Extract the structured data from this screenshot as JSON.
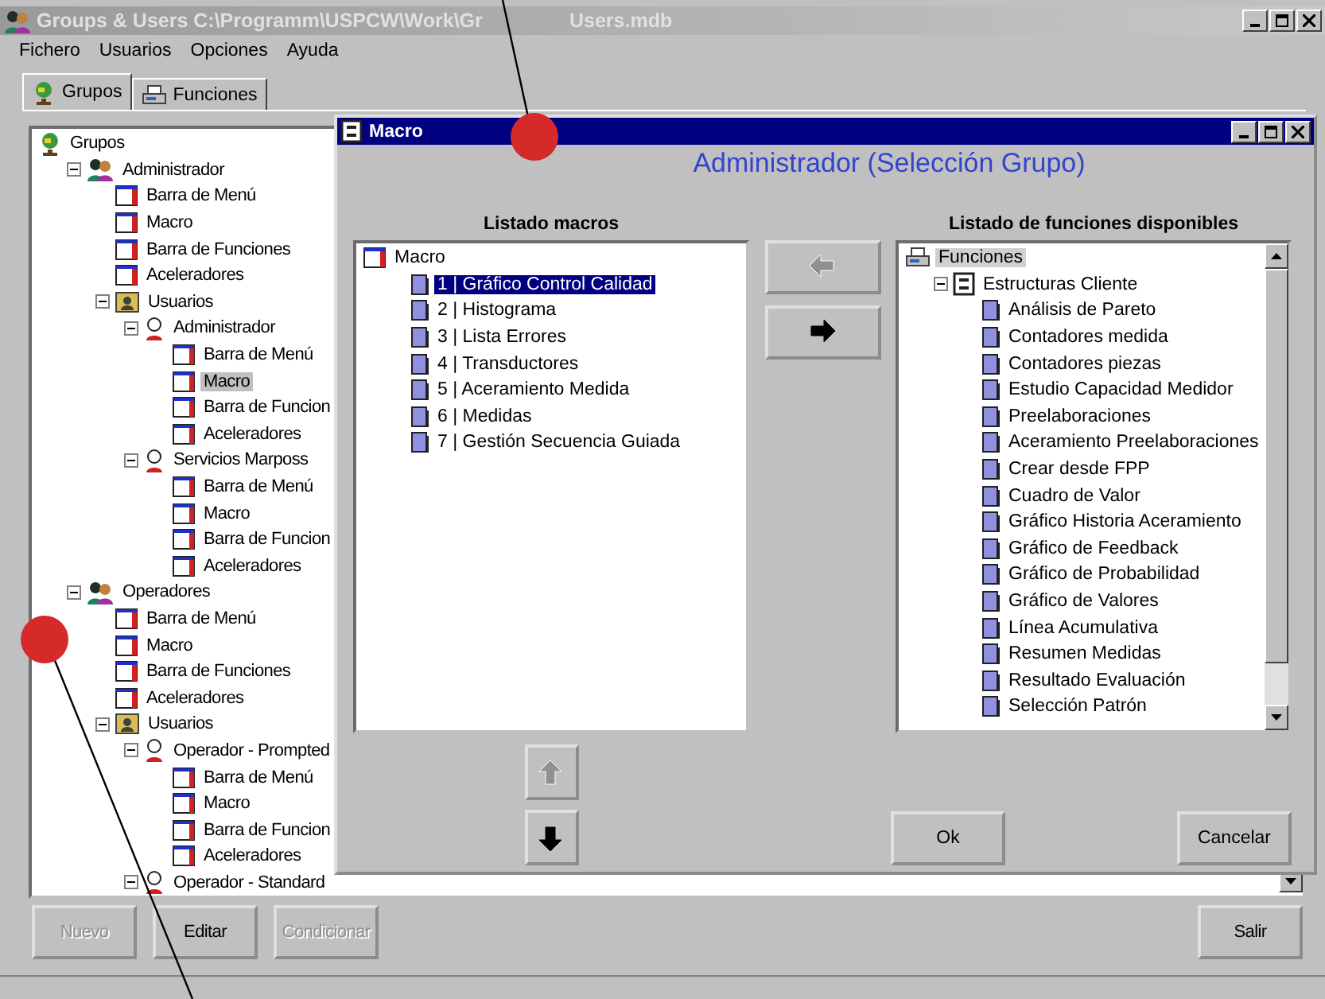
{
  "window": {
    "title_left": "Groups & Users C:\\Programm\\USPCW\\Work\\Gr",
    "title_right": "Users.mdb"
  },
  "menu": [
    "Fichero",
    "Usuarios",
    "Opciones",
    "Ayuda"
  ],
  "tabs": [
    {
      "kind": "groups",
      "label": "Grupos",
      "selected": true
    },
    {
      "kind": "functions",
      "label": "Funciones",
      "selected": false
    }
  ],
  "tree": [
    {
      "kind": "root",
      "label": "Grupos",
      "selected": false,
      "children": [
        {
          "kind": "group",
          "label": "Administrador",
          "expanded": true,
          "selected": false,
          "children": [
            {
              "kind": "leaf",
              "label": "Barra de Menú",
              "selected": false
            },
            {
              "kind": "leaf",
              "label": "Macro",
              "selected": false
            },
            {
              "kind": "leaf",
              "label": "Barra de Funciones",
              "selected": false
            },
            {
              "kind": "leaf",
              "label": "Aceleradores",
              "selected": false
            },
            {
              "kind": "folder",
              "label": "Usuarios",
              "expanded": true,
              "selected": false,
              "children": [
                {
                  "kind": "user",
                  "label": "Administrador",
                  "expanded": true,
                  "selected": false,
                  "children": [
                    {
                      "kind": "leaf",
                      "label": "Barra de Menú",
                      "selected": false
                    },
                    {
                      "kind": "leaf",
                      "label": "Macro",
                      "selected": true
                    },
                    {
                      "kind": "leaf",
                      "label": "Barra de Funcion",
                      "selected": false
                    },
                    {
                      "kind": "leaf",
                      "label": "Aceleradores",
                      "selected": false
                    }
                  ]
                },
                {
                  "kind": "user",
                  "label": "Servicios Marposs",
                  "expanded": true,
                  "selected": false,
                  "children": [
                    {
                      "kind": "leaf",
                      "label": "Barra de Menú",
                      "selected": false
                    },
                    {
                      "kind": "leaf",
                      "label": "Macro",
                      "selected": false
                    },
                    {
                      "kind": "leaf",
                      "label": "Barra de Funcion",
                      "selected": false
                    },
                    {
                      "kind": "leaf",
                      "label": "Aceleradores",
                      "selected": false
                    }
                  ]
                }
              ]
            }
          ]
        },
        {
          "kind": "group",
          "label": "Operadores",
          "expanded": true,
          "selected": false,
          "children": [
            {
              "kind": "leaf",
              "label": "Barra de Menú",
              "selected": false
            },
            {
              "kind": "leaf",
              "label": "Macro",
              "selected": false
            },
            {
              "kind": "leaf",
              "label": "Barra de Funciones",
              "selected": false
            },
            {
              "kind": "leaf",
              "label": "Aceleradores",
              "selected": false
            },
            {
              "kind": "folder",
              "label": "Usuarios",
              "expanded": true,
              "selected": false,
              "children": [
                {
                  "kind": "user",
                  "label": "Operador - Prompted",
                  "expanded": true,
                  "selected": false,
                  "children": [
                    {
                      "kind": "leaf",
                      "label": "Barra de Menú",
                      "selected": false
                    },
                    {
                      "kind": "leaf",
                      "label": "Macro",
                      "selected": false
                    },
                    {
                      "kind": "leaf",
                      "label": "Barra de Funcion",
                      "selected": false
                    },
                    {
                      "kind": "leaf",
                      "label": "Aceleradores",
                      "selected": false
                    }
                  ]
                },
                {
                  "kind": "user",
                  "label": "Operador - Standard",
                  "expanded": true,
                  "selected": false
                }
              ]
            }
          ]
        }
      ]
    }
  ],
  "buttons": [
    {
      "label": "Nuevo",
      "disabled": true
    },
    {
      "label": "Editar",
      "disabled": false
    },
    {
      "label": "Condicionar",
      "disabled": true
    }
  ],
  "exit_button": {
    "label": "Salir",
    "disabled": false
  },
  "dialog": {
    "title": "Macro",
    "heading": "Administrador (Selección Grupo)",
    "macros_label": "Listado macros",
    "macros": [
      {
        "kind": "leaf",
        "label": "Macro",
        "selected": false,
        "children": [
          {
            "kind": "page",
            "label": "1 | Gráfico Control Calidad",
            "selected": true
          },
          {
            "kind": "page",
            "label": "2 | Histograma",
            "selected": false
          },
          {
            "kind": "page",
            "label": "3 | Lista Errores",
            "selected": false
          },
          {
            "kind": "page",
            "label": "4 | Transductores",
            "selected": false
          },
          {
            "kind": "page",
            "label": "5 | Aceramiento Medida",
            "selected": false
          },
          {
            "kind": "page",
            "label": "6 | Medidas",
            "selected": false
          },
          {
            "kind": "page",
            "label": "7 | Gestión Secuencia Guiada",
            "selected": false
          }
        ]
      }
    ],
    "transfer_buttons": [
      {
        "kind": "left",
        "disabled": true
      },
      {
        "kind": "right",
        "disabled": false
      }
    ],
    "functions_label": "Listado de funciones disponibles",
    "functions": [
      {
        "kind": "printer",
        "label": "Funciones",
        "selected": true,
        "children": [
          {
            "kind": "cabinet",
            "label": "Estructuras Cliente",
            "expanded": true,
            "selected": false,
            "children": [
              {
                "kind": "page",
                "label": "Análisis de Pareto",
                "selected": false
              },
              {
                "kind": "page",
                "label": "Contadores medida",
                "selected": false
              },
              {
                "kind": "page",
                "label": "Contadores piezas",
                "selected": false
              },
              {
                "kind": "page",
                "label": "Estudio Capacidad Medidor",
                "selected": false
              },
              {
                "kind": "page",
                "label": "Preelaboraciones",
                "selected": false
              },
              {
                "kind": "page",
                "label": "Aceramiento Preelaboraciones",
                "selected": false
              },
              {
                "kind": "page",
                "label": "Crear desde FPP",
                "selected": false
              },
              {
                "kind": "page",
                "label": "Cuadro de Valor",
                "selected": false
              },
              {
                "kind": "page",
                "label": "Gráfico Historia Aceramiento",
                "selected": false
              },
              {
                "kind": "page",
                "label": "Gráfico de Feedback",
                "selected": false
              },
              {
                "kind": "page",
                "label": "Gráfico de Probabilidad",
                "selected": false
              },
              {
                "kind": "page",
                "label": "Gráfico de Valores",
                "selected": false
              },
              {
                "kind": "page",
                "label": "Línea Acumulativa",
                "selected": false
              },
              {
                "kind": "page",
                "label": "Resumen Medidas",
                "selected": false
              },
              {
                "kind": "page",
                "label": "Resultado Evaluación",
                "selected": false
              },
              {
                "kind": "page",
                "label": "Selección Patrón",
                "selected": false
              }
            ]
          }
        ]
      }
    ],
    "move_buttons": [
      {
        "kind": "up",
        "disabled": true
      },
      {
        "kind": "down",
        "disabled": false
      }
    ],
    "ok_button": {
      "label": "Ok"
    },
    "cancel_button": {
      "label": "Cancelar"
    }
  }
}
